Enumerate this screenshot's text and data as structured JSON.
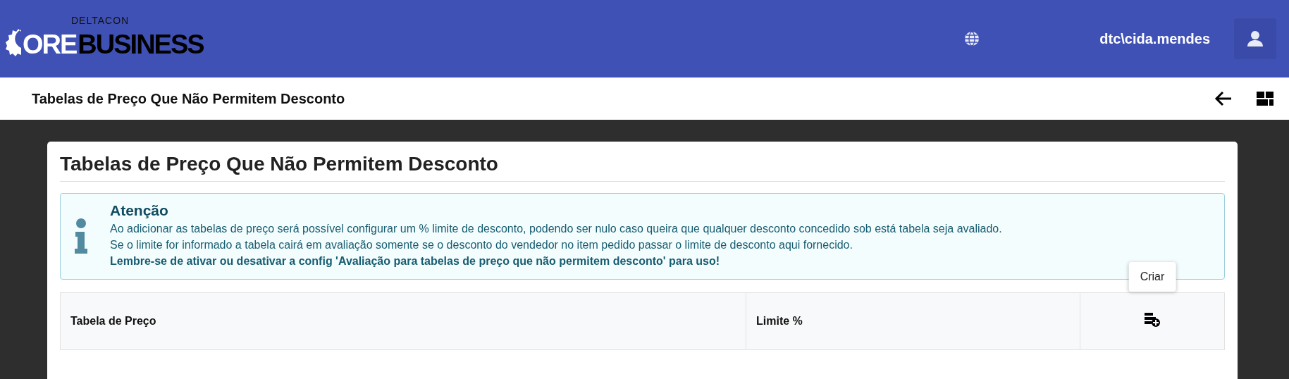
{
  "header": {
    "logo": {
      "tagline": "DELTACON",
      "word_1": "ORE",
      "word_2": "BUSINESS"
    },
    "user": "dtc\\cida.mendes"
  },
  "page_bar": {
    "title": "Tabelas de Preço Que Não Permitem Desconto"
  },
  "card": {
    "title": "Tabelas de Preço Que Não Permitem Desconto",
    "alert": {
      "title": "Atenção",
      "lines": [
        "Ao adicionar as tabelas de preço será possível configurar um % limite de desconto, podendo ser nulo caso queira que qualquer desconto concedido sob está tabela seja avaliado.",
        "Se o limite for informado a tabela cairá em avaliação somente se o desconto do vendedor no item pedido passar o limite de desconto aqui fornecido.",
        "**Lembre-se de ativar ou desativar a config 'Avaliação para tabelas de preço que não permitem desconto' para uso!**"
      ]
    },
    "table": {
      "columns": [
        "Tabela de Preço",
        "Limite %"
      ],
      "create_tooltip": "Criar"
    }
  }
}
